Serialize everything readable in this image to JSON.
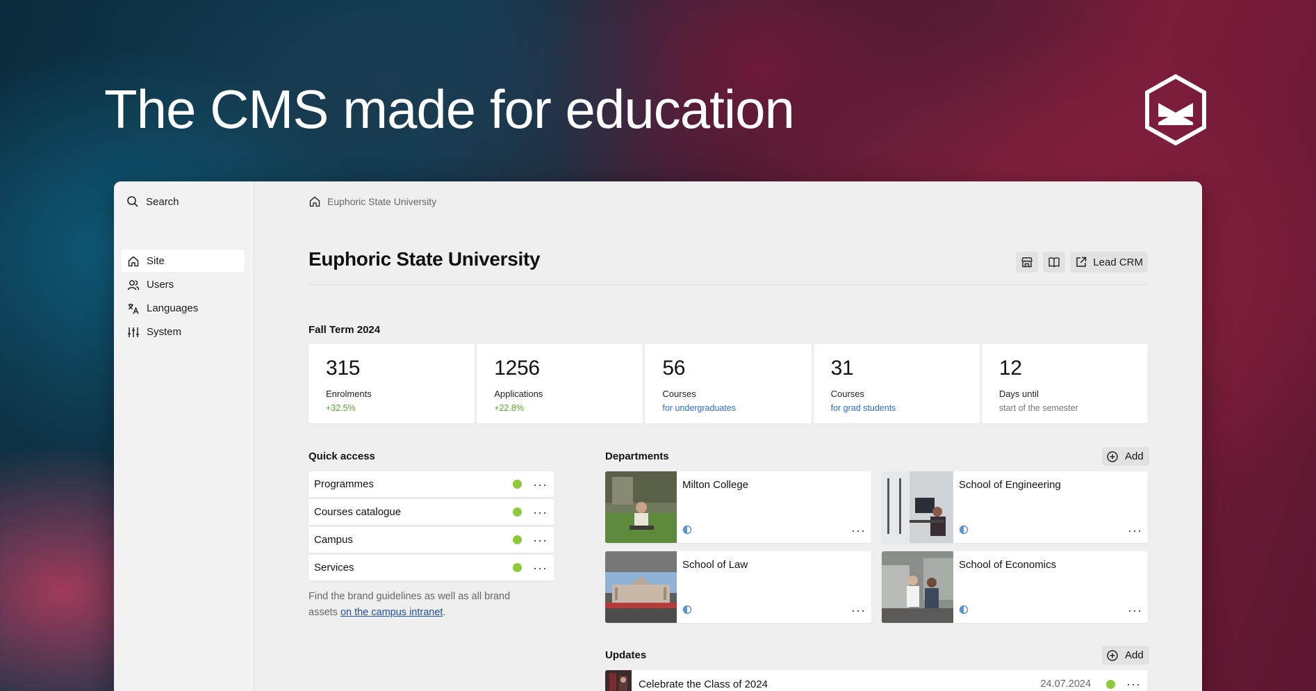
{
  "hero": {
    "title": "The CMS made for education"
  },
  "sidebar": {
    "search_label": "Search",
    "items": [
      {
        "label": "Site",
        "icon": "home-icon",
        "active": true
      },
      {
        "label": "Users",
        "icon": "users-icon",
        "active": false
      },
      {
        "label": "Languages",
        "icon": "translate-icon",
        "active": false
      },
      {
        "label": "System",
        "icon": "sliders-icon",
        "active": false
      }
    ]
  },
  "breadcrumb": {
    "label": "Euphoric State University"
  },
  "page": {
    "title": "Euphoric State University",
    "actions": {
      "lead_crm_label": "Lead CRM"
    }
  },
  "term": {
    "label": "Fall Term 2024",
    "stats": [
      {
        "value": "315",
        "label": "Enrolments",
        "sub": "+32.5%",
        "sub_color": "#5ba52c"
      },
      {
        "value": "1256",
        "label": "Applications",
        "sub": "+22.8%",
        "sub_color": "#5ba52c"
      },
      {
        "value": "56",
        "label": "Courses",
        "sub": "for undergraduates",
        "sub_color": "#2b6fd1"
      },
      {
        "value": "31",
        "label": "Courses",
        "sub": "for grad students",
        "sub_color": "#2b6fd1"
      },
      {
        "value": "12",
        "label": "Days until",
        "sub": "start of the semester",
        "sub_color": "#777777"
      }
    ]
  },
  "quick_access": {
    "label": "Quick access",
    "items": [
      {
        "label": "Programmes"
      },
      {
        "label": "Courses catalogue"
      },
      {
        "label": "Campus"
      },
      {
        "label": "Services"
      }
    ],
    "note_prefix": "Find the brand guidelines as well as all brand assets ",
    "note_link": "on the campus intranet",
    "note_suffix": "."
  },
  "departments": {
    "label": "Departments",
    "add_label": "Add",
    "items": [
      {
        "name": "Milton College"
      },
      {
        "name": "School of Engineering"
      },
      {
        "name": "School of Law"
      },
      {
        "name": "School of Economics"
      }
    ]
  },
  "updates": {
    "label": "Updates",
    "add_label": "Add",
    "items": [
      {
        "title": "Celebrate the Class of 2024",
        "date": "24.07.2024"
      }
    ]
  },
  "colors": {
    "status_green": "#8fc93a",
    "link_blue": "#1d4fa8"
  }
}
